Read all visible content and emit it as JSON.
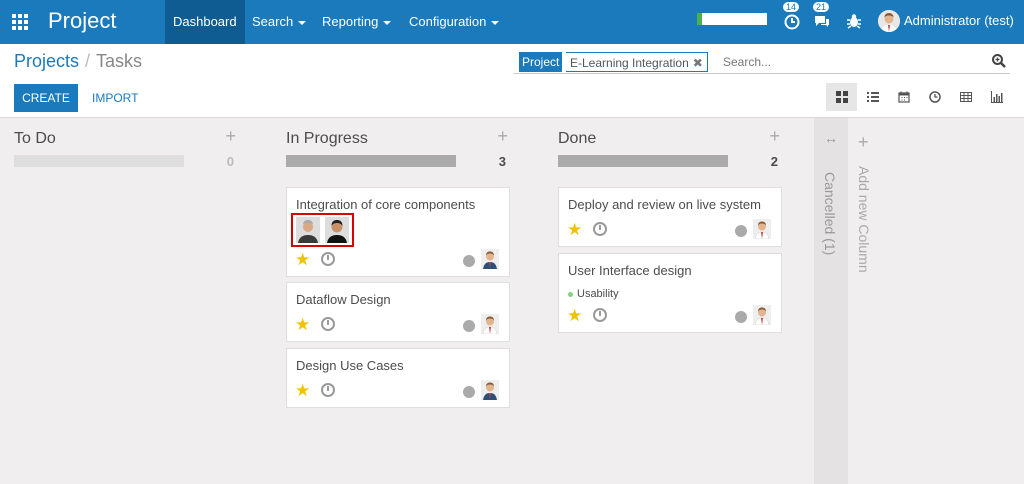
{
  "app": {
    "title": "Project"
  },
  "menu": {
    "dashboard": "Dashboard",
    "search": "Search",
    "reporting": "Reporting",
    "configuration": "Configuration"
  },
  "systray": {
    "activity_count": "14",
    "messages_count": "21",
    "user_name": "Administrator (test)"
  },
  "breadcrumb": {
    "parent": "Projects",
    "separator": "/",
    "current": "Tasks"
  },
  "buttons": {
    "create": "CREATE",
    "import": "IMPORT"
  },
  "search": {
    "facet_category": "Project",
    "facet_value": "E-Learning Integration",
    "facet_remove": "✖",
    "placeholder": "Search..."
  },
  "columns": [
    {
      "title": "To Do",
      "count": "0",
      "cards": []
    },
    {
      "title": "In Progress",
      "count": "3",
      "cards": [
        {
          "title": "Integration of core components",
          "starred": true,
          "has_followers": true
        },
        {
          "title": "Dataflow Design",
          "starred": true
        },
        {
          "title": "Design Use Cases",
          "starred": true
        }
      ]
    },
    {
      "title": "Done",
      "count": "2",
      "cards": [
        {
          "title": "Deploy and review on live system",
          "starred": true
        },
        {
          "title": "User Interface design",
          "starred": true,
          "tag": "Usability"
        }
      ]
    }
  ],
  "folded_column": {
    "label": "Cancelled (1)",
    "icon": "expand-arrows-icon"
  },
  "add_column": {
    "label": "Add new Column"
  },
  "colors": {
    "brand": "#1a7abb",
    "star": "#f0c300",
    "tag_green": "#7ed37e"
  }
}
